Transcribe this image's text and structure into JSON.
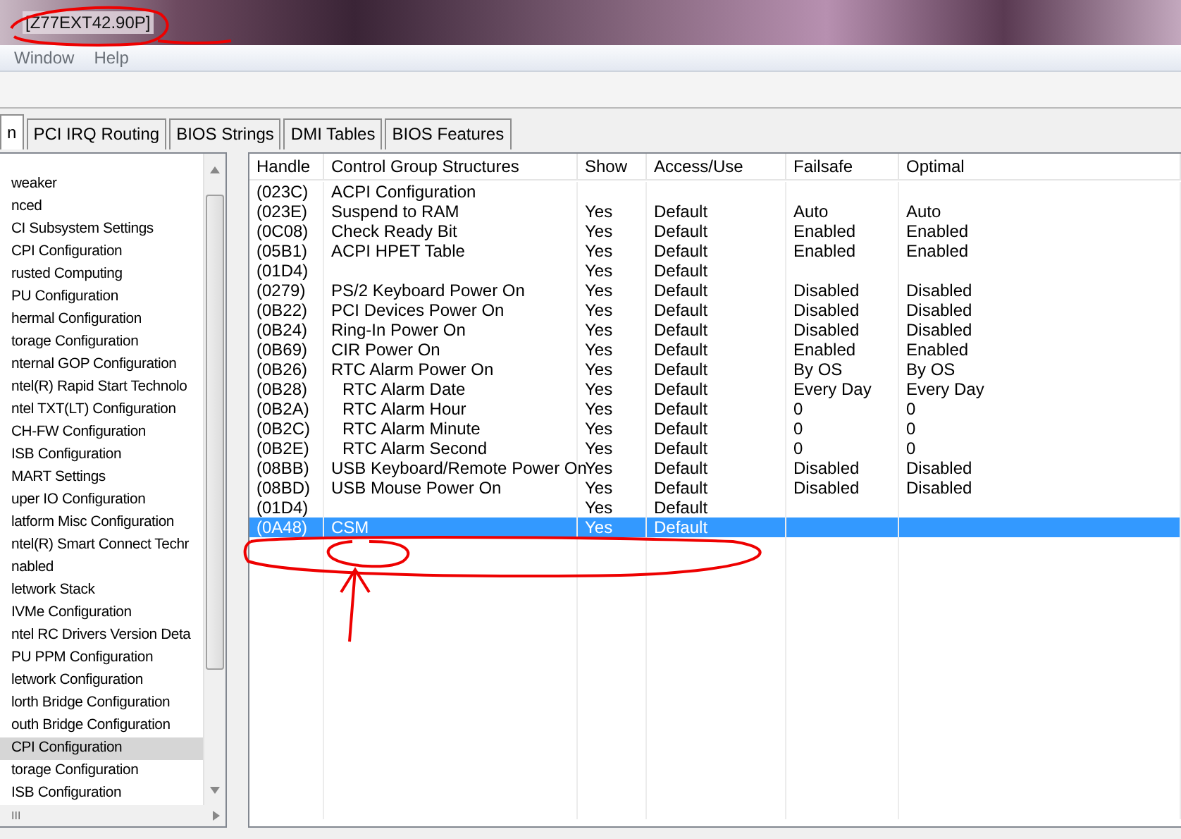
{
  "window": {
    "title": "[Z77EXT42.90P]"
  },
  "menu": [
    "Window",
    "Help"
  ],
  "tabs": [
    {
      "label": "n",
      "selected": true
    },
    {
      "label": "PCI IRQ Routing",
      "selected": false
    },
    {
      "label": "BIOS Strings",
      "selected": false
    },
    {
      "label": "DMI Tables",
      "selected": false
    },
    {
      "label": "BIOS Features",
      "selected": false
    }
  ],
  "tree": {
    "items": [
      {
        "label": "weaker",
        "selected": false
      },
      {
        "label": "nced",
        "selected": false
      },
      {
        "label": "CI Subsystem Settings",
        "selected": false
      },
      {
        "label": "CPI Configuration",
        "selected": false
      },
      {
        "label": "rusted Computing",
        "selected": false
      },
      {
        "label": "PU Configuration",
        "selected": false
      },
      {
        "label": "hermal Configuration",
        "selected": false
      },
      {
        "label": "torage Configuration",
        "selected": false
      },
      {
        "label": "nternal GOP Configuration",
        "selected": false
      },
      {
        "label": "ntel(R) Rapid Start Technolo",
        "selected": false
      },
      {
        "label": "ntel TXT(LT) Configuration",
        "selected": false
      },
      {
        "label": "CH-FW Configuration",
        "selected": false
      },
      {
        "label": "ISB Configuration",
        "selected": false
      },
      {
        "label": "MART Settings",
        "selected": false
      },
      {
        "label": "uper IO Configuration",
        "selected": false
      },
      {
        "label": "latform Misc Configuration",
        "selected": false
      },
      {
        "label": "ntel(R) Smart Connect Techr",
        "selected": false
      },
      {
        "label": "nabled",
        "selected": false
      },
      {
        "label": "letwork Stack",
        "selected": false
      },
      {
        "label": "IVMe Configuration",
        "selected": false
      },
      {
        "label": "ntel RC Drivers Version Deta",
        "selected": false
      },
      {
        "label": "PU PPM Configuration",
        "selected": false
      },
      {
        "label": "letwork Configuration",
        "selected": false
      },
      {
        "label": "lorth Bridge Configuration",
        "selected": false
      },
      {
        "label": "outh Bridge Configuration",
        "selected": false
      },
      {
        "label": "CPI Configuration",
        "selected": true
      },
      {
        "label": "torage Configuration",
        "selected": false
      },
      {
        "label": "ISB Configuration",
        "selected": false
      }
    ],
    "scroll_grip": "III"
  },
  "table": {
    "columns": [
      "Handle",
      "Control Group Structures",
      "Show",
      "Access/Use",
      "Failsafe",
      "Optimal"
    ],
    "rows": [
      {
        "cells": [
          "(023C)",
          "ACPI Configuration",
          "",
          "",
          "",
          ""
        ],
        "selected": false
      },
      {
        "cells": [
          "(023E)",
          "Suspend to RAM",
          "Yes",
          "Default",
          "Auto",
          "Auto"
        ],
        "selected": false
      },
      {
        "cells": [
          "(0C08)",
          "Check Ready Bit",
          "Yes",
          "Default",
          "Enabled",
          "Enabled"
        ],
        "selected": false
      },
      {
        "cells": [
          "(05B1)",
          "ACPI HPET Table",
          "Yes",
          "Default",
          "Enabled",
          "Enabled"
        ],
        "selected": false
      },
      {
        "cells": [
          "(01D4)",
          "",
          "Yes",
          "Default",
          "",
          ""
        ],
        "selected": false
      },
      {
        "cells": [
          "(0279)",
          "PS/2 Keyboard Power On",
          "Yes",
          "Default",
          "Disabled",
          "Disabled"
        ],
        "selected": false
      },
      {
        "cells": [
          "(0B22)",
          "PCI Devices Power On",
          "Yes",
          "Default",
          "Disabled",
          "Disabled"
        ],
        "selected": false
      },
      {
        "cells": [
          "(0B24)",
          "Ring-In Power On",
          "Yes",
          "Default",
          "Disabled",
          "Disabled"
        ],
        "selected": false
      },
      {
        "cells": [
          "(0B69)",
          "CIR Power On",
          "Yes",
          "Default",
          "Enabled",
          "Enabled"
        ],
        "selected": false
      },
      {
        "cells": [
          "(0B26)",
          "RTC Alarm Power On",
          "Yes",
          "Default",
          "By OS",
          "By OS"
        ],
        "selected": false,
        "children": [
          {
            "cells": [
              "(0B28)",
              "RTC Alarm Date",
              "Yes",
              "Default",
              "Every Day",
              "Every Day"
            ],
            "selected": false
          },
          {
            "cells": [
              "(0B2A)",
              "RTC Alarm Hour",
              "Yes",
              "Default",
              "0",
              "0"
            ],
            "selected": false
          },
          {
            "cells": [
              "(0B2C)",
              "RTC Alarm Minute",
              "Yes",
              "Default",
              "0",
              "0"
            ],
            "selected": false
          },
          {
            "cells": [
              "(0B2E)",
              "RTC Alarm Second",
              "Yes",
              "Default",
              "0",
              "0"
            ],
            "selected": false
          }
        ]
      },
      {
        "cells": [
          "(08BB)",
          "USB Keyboard/Remote Power On",
          "Yes",
          "Default",
          "Disabled",
          "Disabled"
        ],
        "selected": false
      },
      {
        "cells": [
          "(08BD)",
          "USB Mouse Power On",
          "Yes",
          "Default",
          "Disabled",
          "Disabled"
        ],
        "selected": false
      },
      {
        "cells": [
          "(01D4)",
          "",
          "Yes",
          "Default",
          "",
          ""
        ],
        "selected": false
      },
      {
        "cells": [
          "(0A48)",
          "CSM",
          "Yes",
          "Default",
          "",
          ""
        ],
        "selected": true
      }
    ]
  }
}
